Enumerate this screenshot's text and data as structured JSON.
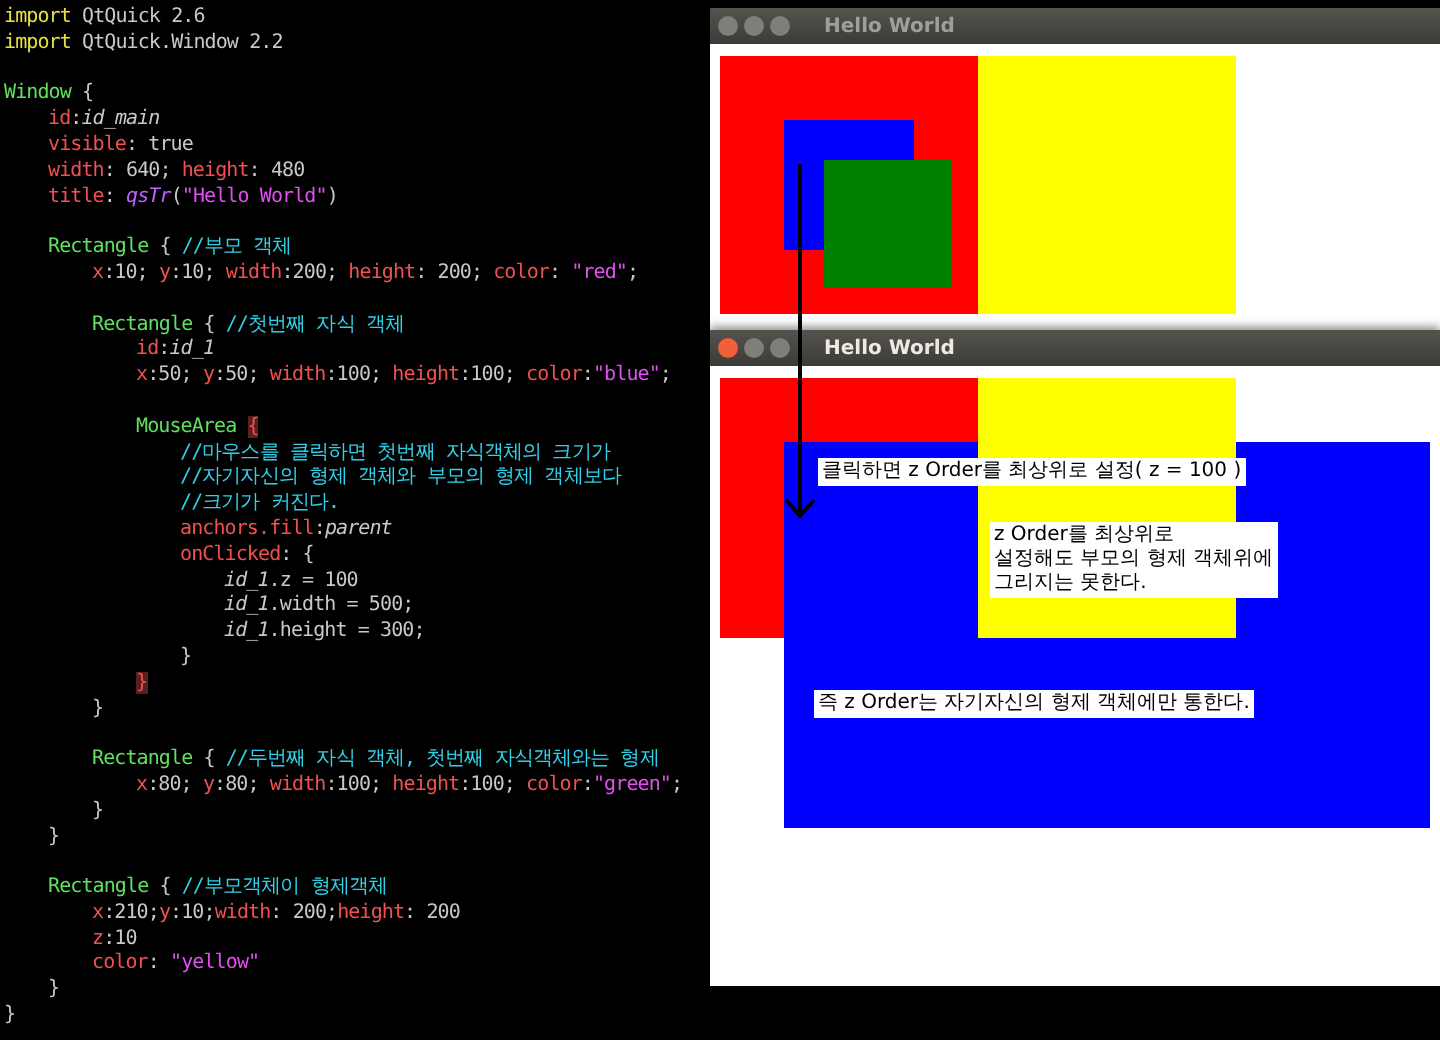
{
  "editor": {
    "lines": [
      {
        "kind": "code",
        "tokens": [
          {
            "kind": "keyword",
            "t": "import"
          },
          {
            "kind": "plain",
            "t": " QtQuick 2.6"
          }
        ]
      },
      {
        "kind": "code",
        "tokens": [
          {
            "kind": "keyword",
            "t": "import"
          },
          {
            "kind": "plain",
            "t": " QtQuick.Window 2.2"
          }
        ]
      },
      {
        "kind": "blank"
      },
      {
        "kind": "code",
        "tokens": [
          {
            "kind": "type",
            "t": "Window"
          },
          {
            "kind": "plain",
            "t": " {"
          }
        ],
        "children": [
          {
            "kind": "code",
            "tokens": [
              {
                "kind": "prop",
                "t": "id"
              },
              {
                "kind": "plain",
                "t": ":"
              },
              {
                "kind": "italic",
                "t": "id_main"
              }
            ]
          },
          {
            "kind": "code",
            "tokens": [
              {
                "kind": "prop",
                "t": "visible"
              },
              {
                "kind": "plain",
                "t": ": true"
              }
            ]
          },
          {
            "kind": "code",
            "tokens": [
              {
                "kind": "prop",
                "t": "width"
              },
              {
                "kind": "plain",
                "t": ": 640; "
              },
              {
                "kind": "prop",
                "t": "height"
              },
              {
                "kind": "plain",
                "t": ": 480"
              }
            ]
          },
          {
            "kind": "code",
            "tokens": [
              {
                "kind": "prop",
                "t": "title"
              },
              {
                "kind": "plain",
                "t": ": "
              },
              {
                "kind": "func",
                "t": "qsTr"
              },
              {
                "kind": "plain",
                "t": "("
              },
              {
                "kind": "string",
                "t": "\"Hello World\""
              },
              {
                "kind": "plain",
                "t": ")"
              }
            ]
          },
          {
            "kind": "blank"
          },
          {
            "kind": "code",
            "tokens": [
              {
                "kind": "type",
                "t": "Rectangle"
              },
              {
                "kind": "plain",
                "t": " { "
              },
              {
                "kind": "comment",
                "t": "//부모 객체"
              }
            ],
            "children": [
              {
                "kind": "code",
                "tokens": [
                  {
                    "kind": "prop",
                    "t": "x"
                  },
                  {
                    "kind": "plain",
                    "t": ":10; "
                  },
                  {
                    "kind": "prop",
                    "t": "y"
                  },
                  {
                    "kind": "plain",
                    "t": ":10; "
                  },
                  {
                    "kind": "prop",
                    "t": "width"
                  },
                  {
                    "kind": "plain",
                    "t": ":200; "
                  },
                  {
                    "kind": "prop",
                    "t": "height"
                  },
                  {
                    "kind": "plain",
                    "t": ": 200; "
                  },
                  {
                    "kind": "prop",
                    "t": "color"
                  },
                  {
                    "kind": "plain",
                    "t": ": "
                  },
                  {
                    "kind": "string",
                    "t": "\"red\""
                  },
                  {
                    "kind": "plain",
                    "t": ";"
                  }
                ]
              },
              {
                "kind": "blank"
              },
              {
                "kind": "code",
                "tokens": [
                  {
                    "kind": "type",
                    "t": "Rectangle"
                  },
                  {
                    "kind": "plain",
                    "t": " { "
                  },
                  {
                    "kind": "comment",
                    "t": "//첫번째 자식 객체"
                  }
                ],
                "children": [
                  {
                    "kind": "code",
                    "tokens": [
                      {
                        "kind": "prop",
                        "t": "id"
                      },
                      {
                        "kind": "plain",
                        "t": ":"
                      },
                      {
                        "kind": "italic",
                        "t": "id_1"
                      }
                    ]
                  },
                  {
                    "kind": "code",
                    "tokens": [
                      {
                        "kind": "prop",
                        "t": "x"
                      },
                      {
                        "kind": "plain",
                        "t": ":50; "
                      },
                      {
                        "kind": "prop",
                        "t": "y"
                      },
                      {
                        "kind": "plain",
                        "t": ":50; "
                      },
                      {
                        "kind": "prop",
                        "t": "width"
                      },
                      {
                        "kind": "plain",
                        "t": ":100; "
                      },
                      {
                        "kind": "prop",
                        "t": "height"
                      },
                      {
                        "kind": "plain",
                        "t": ":100; "
                      },
                      {
                        "kind": "prop",
                        "t": "color"
                      },
                      {
                        "kind": "plain",
                        "t": ":"
                      },
                      {
                        "kind": "string",
                        "t": "\"blue\""
                      },
                      {
                        "kind": "plain",
                        "t": ";"
                      }
                    ]
                  },
                  {
                    "kind": "blank"
                  },
                  {
                    "kind": "code",
                    "tokens": [
                      {
                        "kind": "type",
                        "t": "MouseArea "
                      },
                      {
                        "kind": "bracket",
                        "t": "{"
                      }
                    ],
                    "children": [
                      {
                        "kind": "code",
                        "tokens": [
                          {
                            "kind": "comment",
                            "t": "//마우스를 클릭하면 첫번째 자식객체의 크기가"
                          }
                        ]
                      },
                      {
                        "kind": "code",
                        "tokens": [
                          {
                            "kind": "comment",
                            "t": "//자기자신의 형제 객체와 부모의 형제 객체보다"
                          }
                        ]
                      },
                      {
                        "kind": "code",
                        "tokens": [
                          {
                            "kind": "comment",
                            "t": "//크기가 커진다."
                          }
                        ]
                      },
                      {
                        "kind": "code",
                        "tokens": [
                          {
                            "kind": "prop",
                            "t": "anchors.fill"
                          },
                          {
                            "kind": "plain",
                            "t": ":"
                          },
                          {
                            "kind": "italic",
                            "t": "parent"
                          }
                        ]
                      },
                      {
                        "kind": "code",
                        "tokens": [
                          {
                            "kind": "prop",
                            "t": "onClicked"
                          },
                          {
                            "kind": "plain",
                            "t": ": {"
                          }
                        ],
                        "children": [
                          {
                            "kind": "code",
                            "tokens": [
                              {
                                "kind": "italic",
                                "t": "id_1"
                              },
                              {
                                "kind": "plain",
                                "t": ".z = 100"
                              }
                            ]
                          },
                          {
                            "kind": "code",
                            "tokens": [
                              {
                                "kind": "italic",
                                "t": "id_1"
                              },
                              {
                                "kind": "plain",
                                "t": ".width = 500;"
                              }
                            ]
                          },
                          {
                            "kind": "code",
                            "tokens": [
                              {
                                "kind": "italic",
                                "t": "id_1"
                              },
                              {
                                "kind": "plain",
                                "t": ".height = 300;"
                              }
                            ]
                          }
                        ]
                      },
                      {
                        "kind": "code",
                        "tokens": [
                          {
                            "kind": "plain",
                            "t": "}"
                          }
                        ]
                      }
                    ]
                  },
                  {
                    "kind": "code",
                    "tokens": [
                      {
                        "kind": "bracket",
                        "t": "}"
                      }
                    ]
                  }
                ]
              },
              {
                "kind": "code",
                "tokens": [
                  {
                    "kind": "plain",
                    "t": "}"
                  }
                ]
              },
              {
                "kind": "blank"
              },
              {
                "kind": "code",
                "tokens": [
                  {
                    "kind": "type",
                    "t": "Rectangle"
                  },
                  {
                    "kind": "plain",
                    "t": " { "
                  },
                  {
                    "kind": "comment",
                    "t": "//두번째 자식 객체, 첫번째 자식객체와는 형제"
                  }
                ],
                "children": [
                  {
                    "kind": "code",
                    "tokens": [
                      {
                        "kind": "prop",
                        "t": "x"
                      },
                      {
                        "kind": "plain",
                        "t": ":80; "
                      },
                      {
                        "kind": "prop",
                        "t": "y"
                      },
                      {
                        "kind": "plain",
                        "t": ":80; "
                      },
                      {
                        "kind": "prop",
                        "t": "width"
                      },
                      {
                        "kind": "plain",
                        "t": ":100; "
                      },
                      {
                        "kind": "prop",
                        "t": "height"
                      },
                      {
                        "kind": "plain",
                        "t": ":100; "
                      },
                      {
                        "kind": "prop",
                        "t": "color"
                      },
                      {
                        "kind": "plain",
                        "t": ":"
                      },
                      {
                        "kind": "string",
                        "t": "\"green\""
                      },
                      {
                        "kind": "plain",
                        "t": ";"
                      }
                    ]
                  }
                ]
              },
              {
                "kind": "code",
                "tokens": [
                  {
                    "kind": "plain",
                    "t": "}"
                  }
                ]
              }
            ]
          },
          {
            "kind": "code",
            "tokens": [
              {
                "kind": "plain",
                "t": "}"
              }
            ]
          },
          {
            "kind": "blank"
          },
          {
            "kind": "code",
            "tokens": [
              {
                "kind": "type",
                "t": "Rectangle"
              },
              {
                "kind": "plain",
                "t": " { "
              },
              {
                "kind": "comment",
                "t": "//부모객체이 형제객체"
              }
            ],
            "children": [
              {
                "kind": "code",
                "tokens": [
                  {
                    "kind": "prop",
                    "t": "x"
                  },
                  {
                    "kind": "plain",
                    "t": ":210;"
                  },
                  {
                    "kind": "prop",
                    "t": "y"
                  },
                  {
                    "kind": "plain",
                    "t": ":10;"
                  },
                  {
                    "kind": "prop",
                    "t": "width"
                  },
                  {
                    "kind": "plain",
                    "t": ": 200;"
                  },
                  {
                    "kind": "prop",
                    "t": "height"
                  },
                  {
                    "kind": "plain",
                    "t": ": 200"
                  }
                ]
              },
              {
                "kind": "code",
                "tokens": [
                  {
                    "kind": "prop",
                    "t": "z"
                  },
                  {
                    "kind": "plain",
                    "t": ":10"
                  }
                ]
              },
              {
                "kind": "code",
                "tokens": [
                  {
                    "kind": "prop",
                    "t": "color"
                  },
                  {
                    "kind": "plain",
                    "t": ": "
                  },
                  {
                    "kind": "string",
                    "t": "\"yellow\""
                  }
                ]
              }
            ]
          },
          {
            "kind": "code",
            "tokens": [
              {
                "kind": "plain",
                "t": "}"
              }
            ]
          }
        ]
      },
      {
        "kind": "code",
        "tokens": [
          {
            "kind": "plain",
            "t": "}"
          }
        ]
      }
    ]
  },
  "windows": [
    {
      "title": "Hello World",
      "active": false,
      "shapes": [
        {
          "color": "#ff0000"
        },
        {
          "color": "#0000ff"
        },
        {
          "color": "#008000"
        },
        {
          "color": "#ffff00"
        }
      ]
    },
    {
      "title": "Hello World",
      "active": true,
      "shapes": [
        {
          "color": "#ff0000"
        },
        {
          "color": "#0000ff"
        },
        {
          "color": "#ffff00"
        }
      ],
      "notes": [
        "클릭하면 z Order를 최상위로 설정( z = 100 )",
        "z Order를 최상위로\n설정해도 부모의 형제 객체위에\n그리지는 못한다.",
        "즉 z Order는 자기자신의 형제 객체에만 통한다."
      ]
    }
  ]
}
